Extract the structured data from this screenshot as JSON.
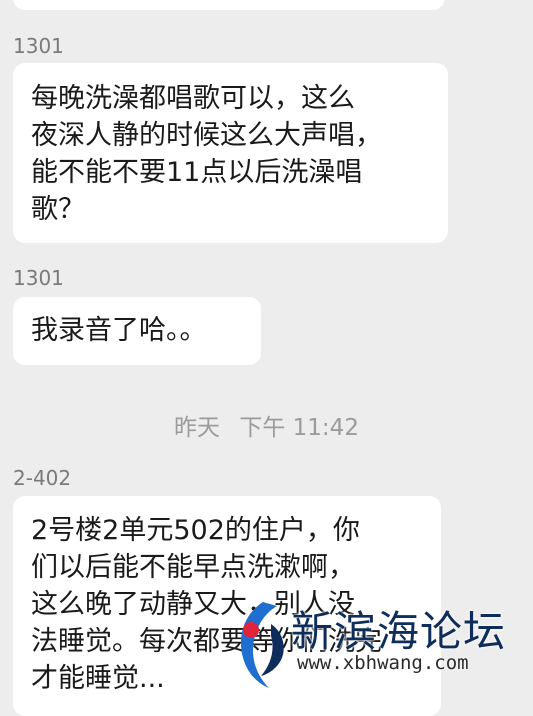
{
  "messages": [
    {
      "sender": "1301",
      "text": "每晚洗澡都唱歌可以，这么\n夜深人静的时候这么大声唱，\n能不能不要11点以后洗澡唱\n歌？"
    },
    {
      "sender": "1301",
      "text": "我录音了哈。。"
    },
    {
      "sender": "2-402",
      "text": "2号楼2单元502的住户，你\n们以后能不能早点洗漱啊，\n这么晚了动静又大，别人没\n法睡觉。每次都要等你们洗完\n才能睡觉..."
    }
  ],
  "timestamp": {
    "day": "昨天",
    "time": "下午 11:42"
  },
  "watermark": {
    "title": "新滨海论坛",
    "url": "www.xbhwang.com"
  },
  "colors": {
    "background": "#ededed",
    "bubble": "#ffffff",
    "watermark_dark": "#0f2d5a",
    "watermark_red": "#e2233c",
    "watermark_blue": "#1f6fd0"
  }
}
